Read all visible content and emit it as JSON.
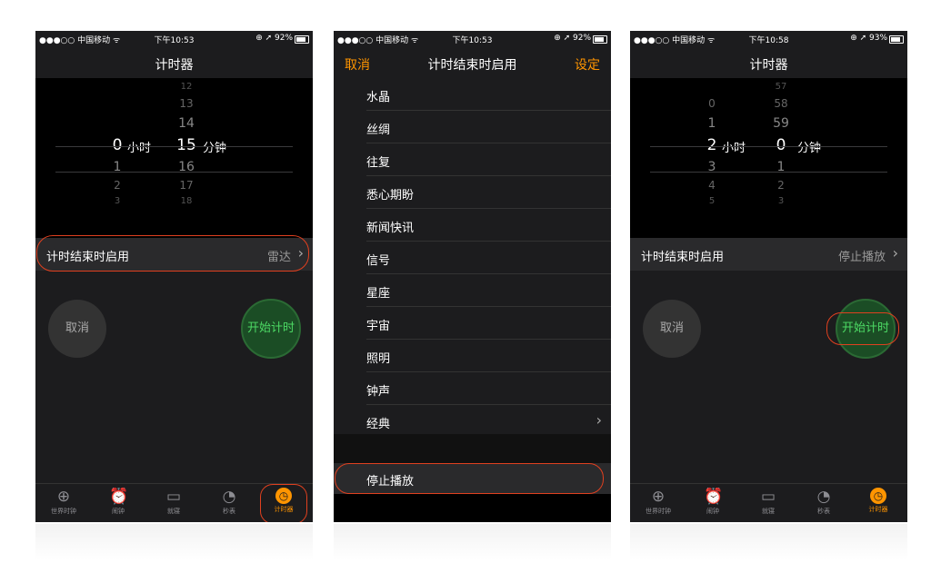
{
  "status_left": "●●●○○ 中国移动 ᯤ",
  "colors": {
    "accent": "#ff9500",
    "start_green": "#4cd964",
    "highlight": "#e0401f"
  },
  "screen1": {
    "status_time": "下午10:53",
    "status_right": "⊕ ➚ 92%",
    "title": "计时器",
    "picker_hours": [
      "",
      "",
      "",
      "0",
      "1",
      "2",
      "3"
    ],
    "picker_minutes": [
      "12",
      "13",
      "14",
      "15",
      "16",
      "17",
      "18"
    ],
    "hours_unit": "小时",
    "minutes_unit": "分钟",
    "row_label": "计时结束时启用",
    "row_value": "雷达",
    "cancel": "取消",
    "start": "开始计时"
  },
  "screen2": {
    "status_time": "下午10:53",
    "status_right": "⊕ ➚ 92%",
    "title": "计时结束时启用",
    "cancel": "取消",
    "set": "设定",
    "sounds": [
      "水晶",
      "丝绸",
      "往复",
      "悉心期盼",
      "新闻快讯",
      "信号",
      "星座",
      "宇宙",
      "照明",
      "钟声",
      "经典"
    ],
    "stop": "停止播放"
  },
  "screen3": {
    "status_time": "下午10:58",
    "status_right": "⊕ ➚ 93%",
    "title": "计时器",
    "picker_hours": [
      "",
      "0",
      "1",
      "2",
      "3",
      "4",
      "5"
    ],
    "picker_minutes": [
      "57",
      "58",
      "59",
      "0",
      "1",
      "2",
      "3"
    ],
    "hours_unit": "小时",
    "minutes_unit": "分钟",
    "row_label": "计时结束时启用",
    "row_value": "停止播放",
    "cancel": "取消",
    "start": "开始计时"
  },
  "tabs": [
    {
      "label": "世界时钟",
      "icon": "globe-icon"
    },
    {
      "label": "闹钟",
      "icon": "alarm-icon"
    },
    {
      "label": "就寝",
      "icon": "bed-icon"
    },
    {
      "label": "秒表",
      "icon": "stopwatch-icon"
    },
    {
      "label": "计时器",
      "icon": "timer-icon"
    }
  ]
}
